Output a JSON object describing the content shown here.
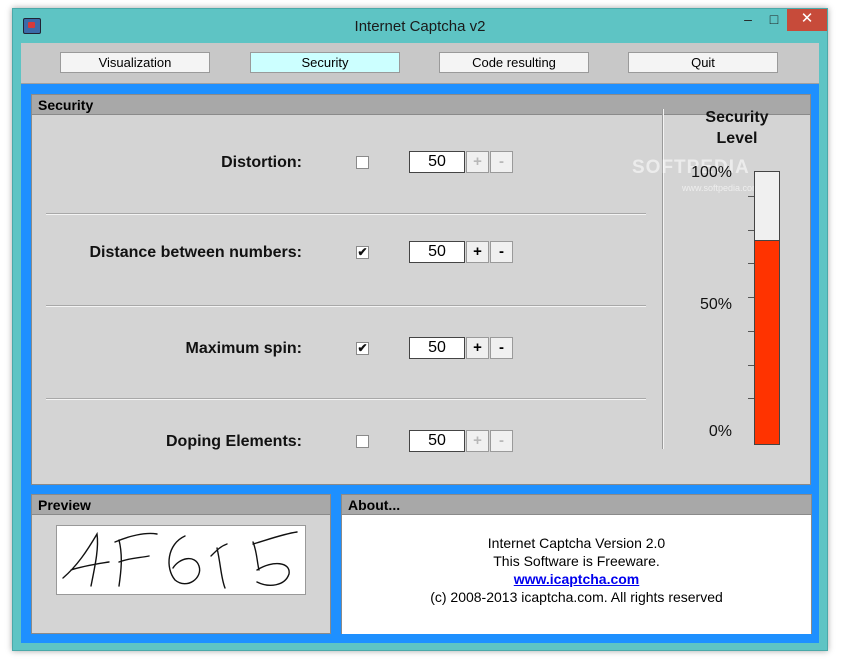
{
  "window": {
    "title": "Internet Captcha v2",
    "controls": {
      "minimize": "–",
      "maximize": "□",
      "close": "✕"
    }
  },
  "nav": {
    "tabs": [
      {
        "label": "Visualization",
        "active": false
      },
      {
        "label": "Security",
        "active": true
      },
      {
        "label": "Code resulting",
        "active": false
      },
      {
        "label": "Quit",
        "active": false
      }
    ]
  },
  "security": {
    "header": "Security",
    "rows": [
      {
        "label": "Distortion:",
        "checked": false,
        "value": "50",
        "plus": "+",
        "minus": "-",
        "steppers_enabled": false
      },
      {
        "label": "Distance between numbers:",
        "checked": true,
        "value": "50",
        "plus": "+",
        "minus": "-",
        "steppers_enabled": true
      },
      {
        "label": "Maximum spin:",
        "checked": true,
        "value": "50",
        "plus": "+",
        "minus": "-",
        "steppers_enabled": true
      },
      {
        "label": "Doping Elements:",
        "checked": false,
        "value": "50",
        "plus": "+",
        "minus": "-",
        "steppers_enabled": false
      }
    ],
    "check_glyph": "✔",
    "level": {
      "title_line1": "Security",
      "title_line2": "Level",
      "scale_top": "100%",
      "scale_mid": "50%",
      "scale_bottom": "0%",
      "fill_percent": 75,
      "fill_color": "#ff3300"
    },
    "watermark": "SOFTPEDIA",
    "watermark_sub": "www.softpedia.com"
  },
  "preview": {
    "header": "Preview"
  },
  "about": {
    "header": "About...",
    "lines": [
      "Internet Captcha Version 2.0",
      "This Software is Freeware.",
      "www.icaptcha.com",
      "(c) 2008-2013 icaptcha.com. All rights reserved"
    ]
  },
  "colors": {
    "titlebar": "#5ec4c4",
    "client_bg": "#1e90ff",
    "active_tab": "#ccffff",
    "close_button": "#c74b3a"
  }
}
